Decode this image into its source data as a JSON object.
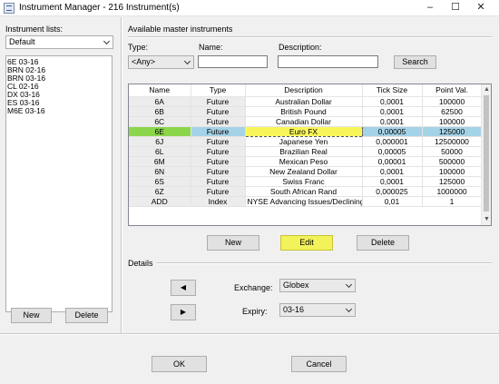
{
  "window": {
    "title": "Instrument Manager - 216 Instrument(s)",
    "controls": [
      "–",
      "☐",
      "✕"
    ]
  },
  "left": {
    "lists_label": "Instrument lists:",
    "list_selector": "Default",
    "items": [
      "6E 03-16",
      "BRN 02-16",
      "BRN 03-16",
      "CL 02-16",
      "DX 03-16",
      "ES 03-16",
      "M6E 03-16"
    ],
    "new_label": "New",
    "delete_label": "Delete"
  },
  "master": {
    "section_label": "Available master instruments",
    "type_label": "Type:",
    "type_value": "<Any>",
    "name_label": "Name:",
    "name_value": "",
    "description_label": "Description:",
    "description_value": "",
    "search_label": "Search",
    "columns": [
      "Name",
      "Type",
      "Description",
      "Tick Size",
      "Point Val."
    ],
    "rows": [
      [
        "6A",
        "Future",
        "Australian Dollar",
        "0,0001",
        "100000"
      ],
      [
        "6B",
        "Future",
        "British Pound",
        "0,0001",
        "62500"
      ],
      [
        "6C",
        "Future",
        "Canadian Dollar",
        "0,0001",
        "100000"
      ],
      [
        "6E",
        "Future",
        "Euro FX",
        "0,00005",
        "125000"
      ],
      [
        "6J",
        "Future",
        "Japanese Yen",
        "0,000001",
        "12500000"
      ],
      [
        "6L",
        "Future",
        "Brazilian Real",
        "0,00005",
        "50000"
      ],
      [
        "6M",
        "Future",
        "Mexican Peso",
        "0,00001",
        "500000"
      ],
      [
        "6N",
        "Future",
        "New Zealand Dollar",
        "0,0001",
        "100000"
      ],
      [
        "6S",
        "Future",
        "Swiss Franc",
        "0,0001",
        "125000"
      ],
      [
        "6Z",
        "Future",
        "South African Rand",
        "0,000025",
        "1000000"
      ],
      [
        "ADD",
        "Index",
        "NYSE Advancing Issues/Declining",
        "0,01",
        "1"
      ]
    ],
    "selected_row": 3,
    "new_label": "New",
    "edit_label": "Edit",
    "delete_label": "Delete"
  },
  "details": {
    "section_label": "Details",
    "exchange_label": "Exchange:",
    "exchange_value": "Globex",
    "expiry_label": "Expiry:",
    "expiry_value": "03-16",
    "left_arrow": "◀",
    "right_arrow": "▶"
  },
  "footer": {
    "ok_label": "OK",
    "cancel_label": "Cancel"
  },
  "colors": {
    "selected_row": "#a4d2e6",
    "selected_name_highlight": "#8cd64c",
    "selected_description_highlight": "#f8f55a",
    "edit_button_highlight": "#f2f25b"
  }
}
